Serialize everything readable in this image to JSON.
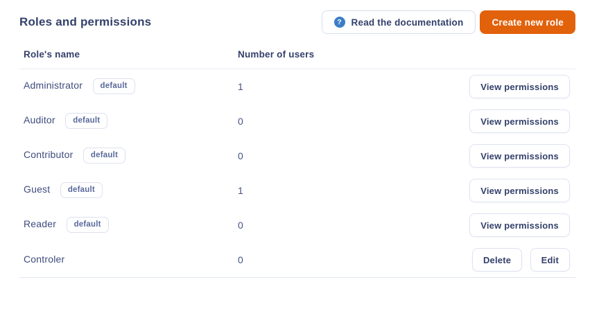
{
  "page": {
    "title": "Roles and permissions"
  },
  "header": {
    "read_docs_label": "Read the documentation",
    "help_icon_glyph": "?",
    "create_role_label": "Create new role"
  },
  "table": {
    "columns": {
      "name": "Role's name",
      "users": "Number of users"
    },
    "badge_label": "default",
    "rows": [
      {
        "name": "Administrator",
        "badge": true,
        "users": "1",
        "actions": [
          "View permissions"
        ]
      },
      {
        "name": "Auditor",
        "badge": true,
        "users": "0",
        "actions": [
          "View permissions"
        ]
      },
      {
        "name": "Contributor",
        "badge": true,
        "users": "0",
        "actions": [
          "View permissions"
        ]
      },
      {
        "name": "Guest",
        "badge": true,
        "users": "1",
        "actions": [
          "View permissions"
        ]
      },
      {
        "name": "Reader",
        "badge": true,
        "users": "0",
        "actions": [
          "View permissions"
        ]
      },
      {
        "name": "Controler",
        "badge": false,
        "users": "0",
        "actions": [
          "Delete",
          "Edit"
        ]
      }
    ]
  },
  "colors": {
    "accent_orange": "#E2610B",
    "help_icon_blue": "#3C7EC6",
    "heading_text": "#33406B",
    "body_text": "#3E4B7C",
    "badge_text": "#5A699B",
    "border_light": "#DEE3F2",
    "header_rule": "#E9ECF4",
    "background": "#FFFFFF"
  }
}
